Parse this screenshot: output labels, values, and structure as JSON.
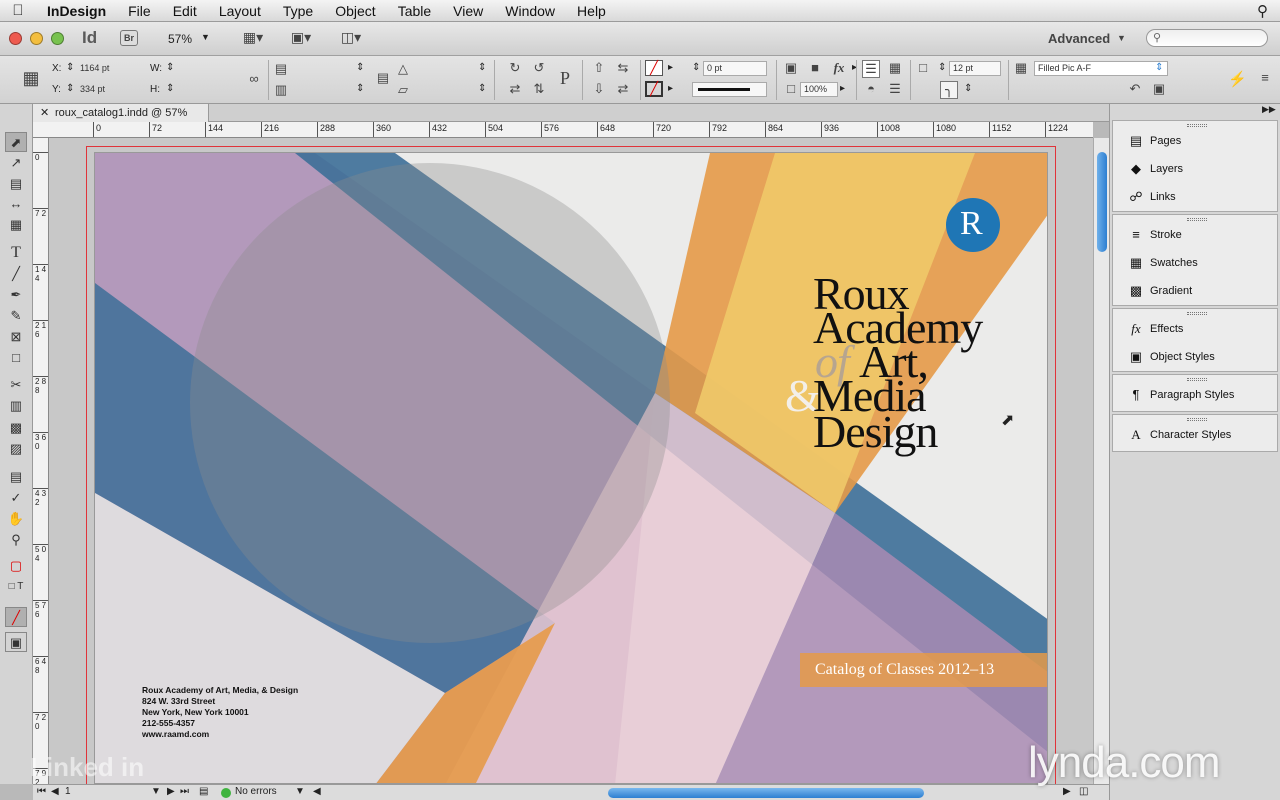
{
  "menubar": {
    "app": "InDesign",
    "items": [
      "File",
      "Edit",
      "Layout",
      "Type",
      "Object",
      "Table",
      "View",
      "Window",
      "Help"
    ]
  },
  "appbar": {
    "logo": "Id",
    "bridge": "Br",
    "zoom": "57%",
    "workspace": "Advanced"
  },
  "control": {
    "x_label": "X:",
    "x_value": "1164 pt",
    "y_label": "Y:",
    "y_value": "334 pt",
    "w_label": "W:",
    "h_label": "H:",
    "stroke_weight": "0 pt",
    "opacity": "100%",
    "inset": "12 pt",
    "object_style": "Filled Pic A-F"
  },
  "document_tab": "roux_catalog1.indd @ 57%",
  "ruler": {
    "h": [
      "0",
      "72",
      "144",
      "216",
      "288",
      "360",
      "432",
      "504",
      "576",
      "648",
      "720",
      "792",
      "864",
      "936",
      "1008",
      "1080",
      "1152",
      "1224"
    ],
    "v": [
      "0",
      "7 2",
      "1 4 4",
      "2 1 6",
      "2 8 8",
      "3 6 0",
      "4 3 2",
      "5 0 4",
      "5 7 6",
      "6 4 8",
      "7 2 0",
      "7 9 2"
    ]
  },
  "artwork": {
    "title_lines": [
      "Roux",
      "Academy",
      "Art,",
      "Media",
      "Design"
    ],
    "title_of": "of",
    "title_amp": "&",
    "logo_letter": "R",
    "catalog": "Catalog of Classes 2012–13",
    "address": [
      "Roux Academy of Art, Media, & Design",
      "824 W. 33rd Street",
      "New York, New York 10001",
      "212-555-4357",
      "www.raamd.com"
    ]
  },
  "status": {
    "page": "1",
    "errors": "No errors"
  },
  "panels": {
    "group1": [
      "Pages",
      "Layers",
      "Links"
    ],
    "group2": [
      "Stroke",
      "Swatches",
      "Gradient"
    ],
    "group3": [
      "Effects",
      "Object Styles"
    ],
    "group4": [
      "Paragraph Styles"
    ],
    "group5": [
      "Character Styles"
    ]
  },
  "watermarks": {
    "left": "Linked in",
    "right": "lynda.com"
  },
  "colors": {
    "purple": "#a98bb3",
    "blue": "#3d6f98",
    "orange": "#e59a48",
    "yellow": "#efc969",
    "pink": "#e7c9d4",
    "logo_blue": "#1f76b5"
  }
}
